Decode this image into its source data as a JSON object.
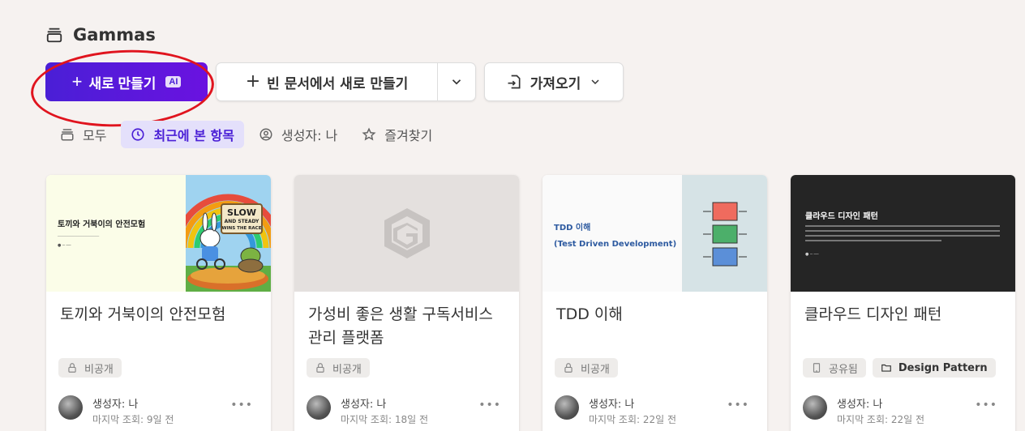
{
  "header": {
    "title": "Gammas",
    "icon": "stack-icon"
  },
  "actions": {
    "create_label": "새로 만들기",
    "ai_badge": "AI",
    "blank_label": "빈 문서에서 새로 만들기",
    "import_label": "가져오기"
  },
  "filters": [
    {
      "label": "모두",
      "icon": "stack-icon",
      "active": false
    },
    {
      "label": "최근에 본 항목",
      "icon": "clock-icon",
      "active": true
    },
    {
      "label": "생성자: 나",
      "icon": "user-circle-icon",
      "active": false
    },
    {
      "label": "즐겨찾기",
      "icon": "star-icon",
      "active": false
    }
  ],
  "colors": {
    "accent": "#4a1fd6",
    "background": "#f6f2f0",
    "annotation": "#e0141e"
  },
  "cards": [
    {
      "title": "토끼와 거북이의 안전모험",
      "thumb_title": "토끼와 거북이의 안전모험",
      "thumb_sign": [
        "SLOW",
        "AND STEADY",
        "WINS THE RACE"
      ],
      "tags": [
        {
          "label": "비공개",
          "icon": "lock-icon"
        }
      ],
      "author": "생성자: 나",
      "viewed": "마지막 조회: 9일 전"
    },
    {
      "title": "가성비 좋은 생활 구독서비스 관리 플랫폼",
      "tags": [
        {
          "label": "비공개",
          "icon": "lock-icon"
        }
      ],
      "author": "생성자: 나",
      "viewed": "마지막 조회: 18일 전"
    },
    {
      "title": "TDD 이해",
      "thumb_title": "TDD 이해",
      "thumb_subtitle": "(Test Driven Development)",
      "tags": [
        {
          "label": "비공개",
          "icon": "lock-icon"
        }
      ],
      "author": "생성자: 나",
      "viewed": "마지막 조회: 22일 전"
    },
    {
      "title": "클라우드 디자인 패턴",
      "thumb_title": "클라우드 디자인 패턴",
      "tags": [
        {
          "label": "공유됨",
          "icon": "building-icon"
        },
        {
          "label": "Design Pattern",
          "icon": "folder-icon"
        }
      ],
      "author": "생성자: 나",
      "viewed": "마지막 조회: 22일 전"
    }
  ]
}
